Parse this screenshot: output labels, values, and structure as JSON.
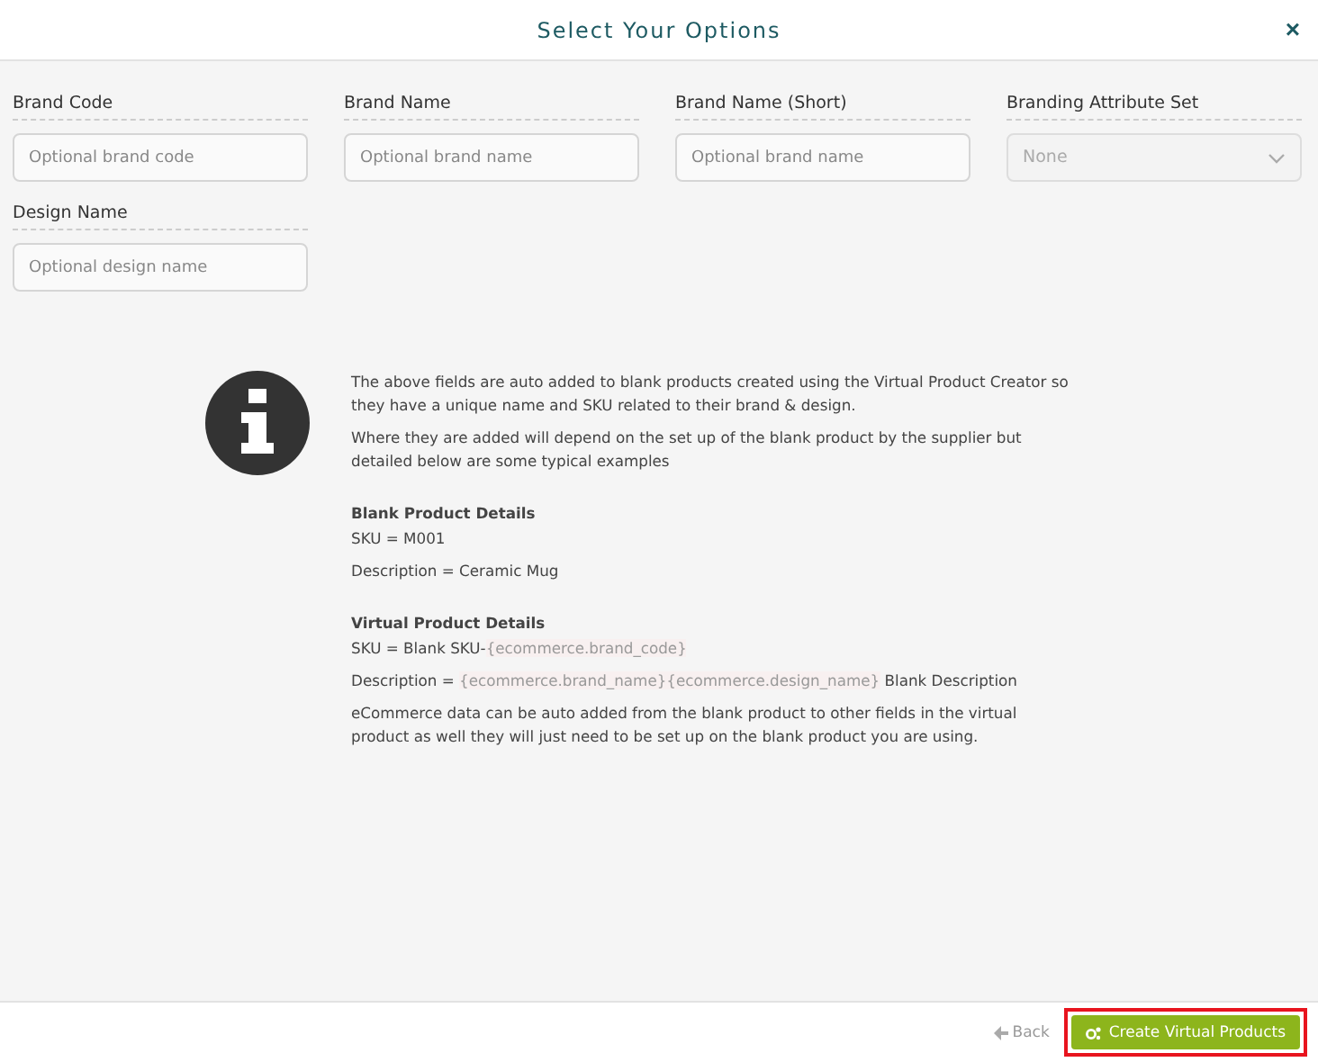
{
  "dialog": {
    "title": "Select Your Options",
    "close": "×"
  },
  "fields": [
    {
      "label": "Brand Code",
      "kind": "text",
      "placeholder": "Optional brand code"
    },
    {
      "label": "Brand Name",
      "kind": "text",
      "placeholder": "Optional brand name"
    },
    {
      "label": "Brand Name (Short)",
      "kind": "text",
      "placeholder": "Optional brand name"
    },
    {
      "label": "Branding Attribute Set",
      "kind": "select",
      "value": "None"
    },
    {
      "label": "Design Name",
      "kind": "text",
      "placeholder": "Optional design name"
    }
  ],
  "info": {
    "blocks": [
      {
        "kind": "para",
        "parts": [
          {
            "text": "The above fields are auto added to blank products created using the Virtual Product Creator so they have a unique name and SKU related to their brand & design.",
            "code": false
          }
        ]
      },
      {
        "kind": "para",
        "parts": [
          {
            "text": "Where they are added will depend on the set up of the blank product by the supplier but detailed below are some typical examples",
            "code": false
          }
        ]
      },
      {
        "kind": "heading",
        "parts": [
          {
            "text": "Blank Product Details",
            "code": false
          }
        ]
      },
      {
        "kind": "line",
        "parts": [
          {
            "text": "SKU = M001",
            "code": false
          }
        ]
      },
      {
        "kind": "line",
        "parts": [
          {
            "text": "Description = Ceramic Mug",
            "code": false
          }
        ]
      },
      {
        "kind": "heading",
        "parts": [
          {
            "text": "Virtual Product Details",
            "code": false
          }
        ]
      },
      {
        "kind": "line",
        "parts": [
          {
            "text": "SKU = Blank SKU-",
            "code": false
          },
          {
            "text": "{ecommerce.brand_code}",
            "code": true
          }
        ]
      },
      {
        "kind": "line",
        "parts": [
          {
            "text": "Description = ",
            "code": false
          },
          {
            "text": "{ecommerce.brand_name}{ecommerce.design_name}",
            "code": true
          },
          {
            "text": " Blank Description",
            "code": false
          }
        ]
      },
      {
        "kind": "para",
        "parts": [
          {
            "text": "eCommerce data can be auto added from the blank product to other fields in the virtual product as well they will just need to be set up on the blank product you are using.",
            "code": false
          }
        ]
      }
    ]
  },
  "footer": {
    "back": "Back",
    "create": "Create Virtual Products",
    "create_highlighted": true
  }
}
